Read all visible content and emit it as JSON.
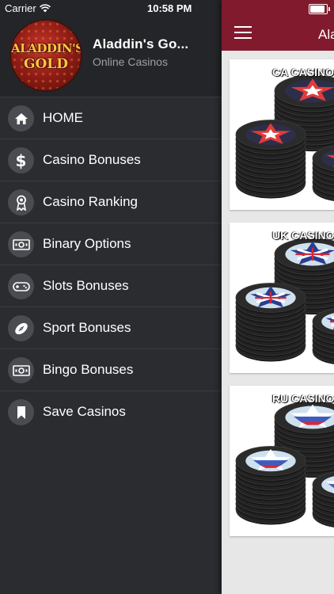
{
  "status": {
    "carrier": "Carrier",
    "time": "10:58 PM",
    "battery_level": 0.95
  },
  "drawer": {
    "app_name": "Aladdin's Go...",
    "app_subtitle": "Online Casinos",
    "logo": {
      "line1": "ALADDIN'S",
      "line2": "GOLD"
    },
    "menu": [
      {
        "label": "HOME",
        "icon": "home-icon"
      },
      {
        "label": "Casino Bonuses",
        "icon": "dollar-icon"
      },
      {
        "label": "Casino Ranking",
        "icon": "ribbon-award-icon"
      },
      {
        "label": "Binary Options",
        "icon": "banknote-icon"
      },
      {
        "label": "Slots Bonuses",
        "icon": "gamepad-icon"
      },
      {
        "label": "Sport Bonuses",
        "icon": "football-icon"
      },
      {
        "label": "Bingo Bonuses",
        "icon": "banknote-icon"
      },
      {
        "label": "Save Casinos",
        "icon": "bookmark-icon"
      }
    ]
  },
  "main": {
    "title": "Aladdin's Gold",
    "cards": [
      {
        "title": "CA CASINOS",
        "flag": "canada"
      },
      {
        "title": "UK CASINOS",
        "flag": "uk"
      },
      {
        "title": "RU CASINOS",
        "flag": "russia"
      }
    ]
  },
  "colors": {
    "navbar": "#821a2e",
    "drawer_bg": "#2a2c30",
    "icon_circle": "#4a4c52"
  }
}
